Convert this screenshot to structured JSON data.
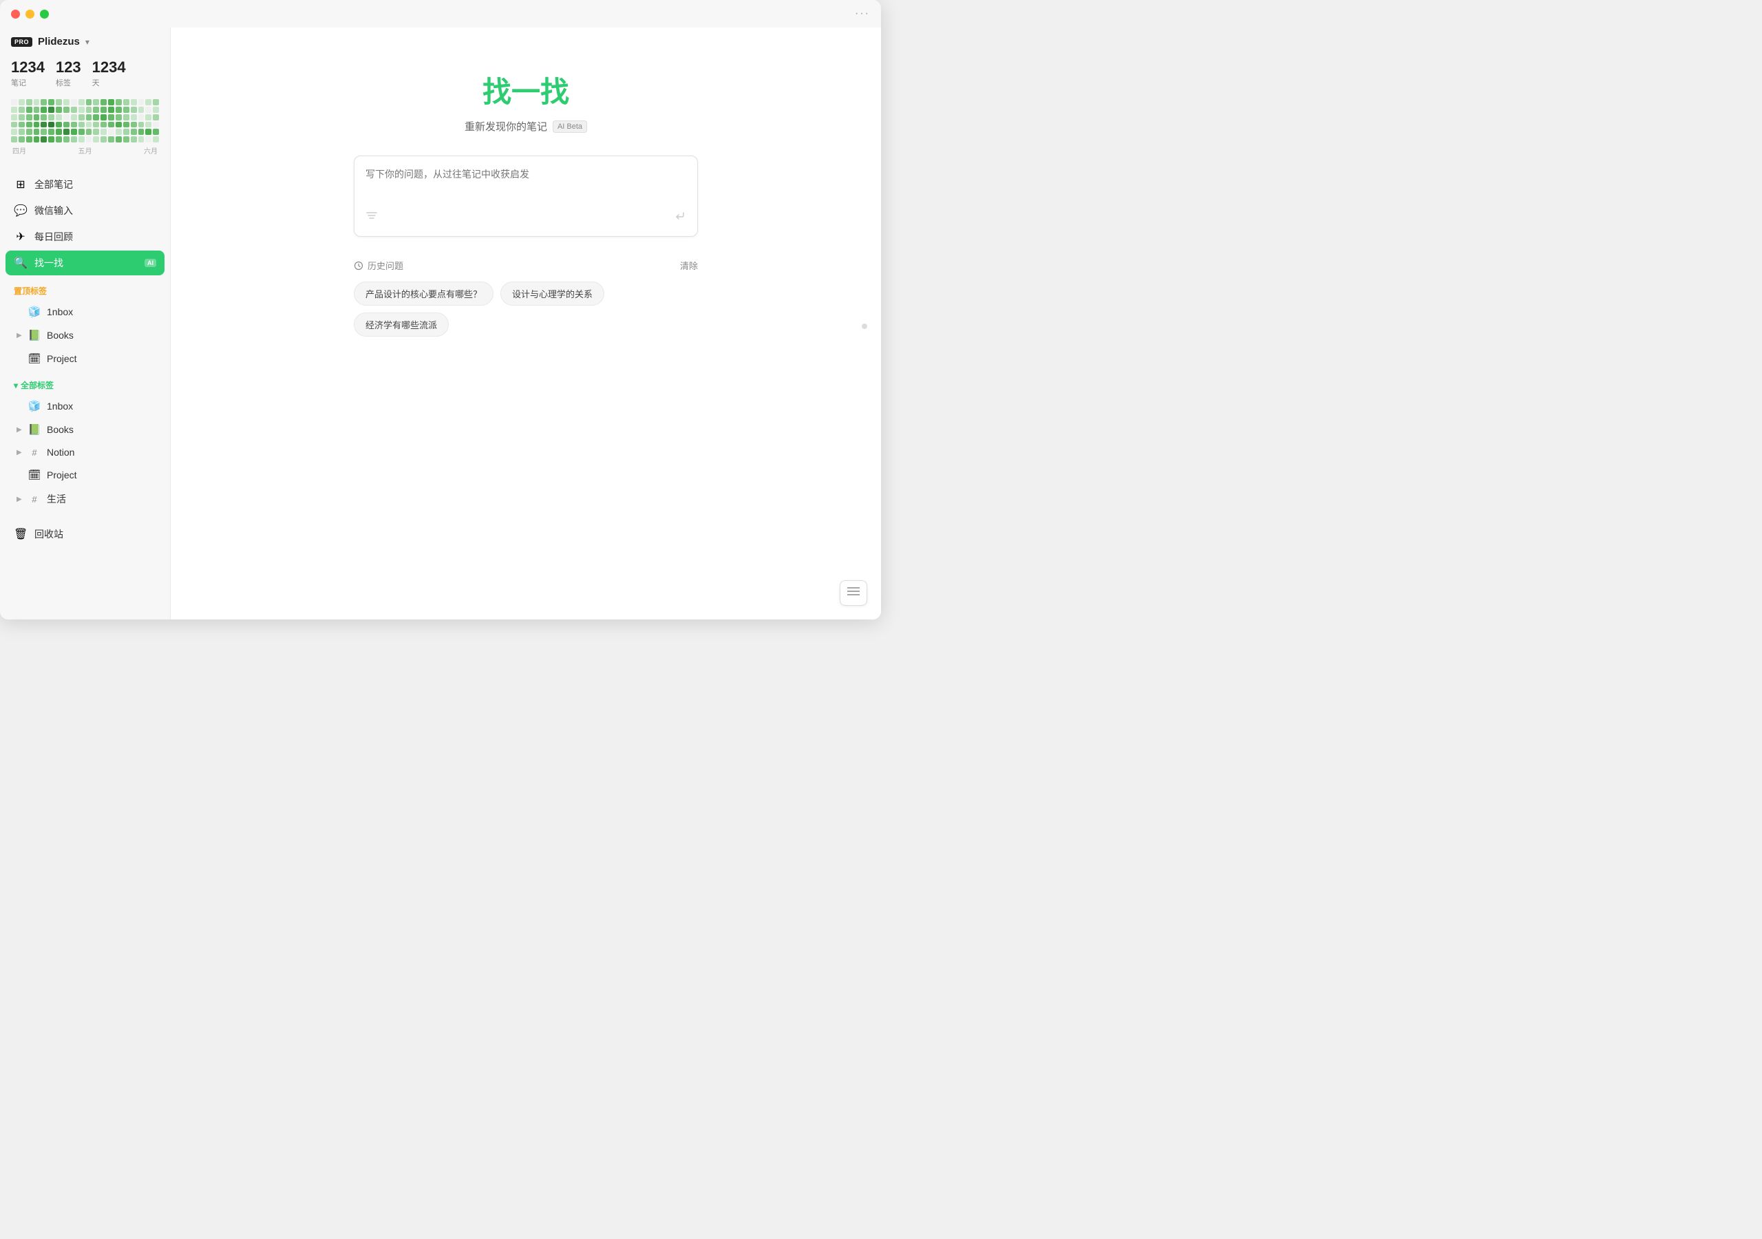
{
  "window": {
    "title": "Plidezus",
    "dots_icon": "···"
  },
  "profile": {
    "pro_label": "PRO",
    "name": "Plidezus",
    "chevron": "▾"
  },
  "stats": [
    {
      "value": "1234",
      "label": "笔记"
    },
    {
      "value": "123",
      "label": "标签"
    },
    {
      "value": "1234",
      "label": "天"
    }
  ],
  "heatmap": {
    "months": [
      "四月",
      "五月",
      "六月"
    ],
    "cells": [
      0,
      1,
      2,
      1,
      3,
      4,
      2,
      1,
      0,
      1,
      3,
      2,
      4,
      5,
      3,
      2,
      1,
      0,
      1,
      2,
      1,
      2,
      4,
      3,
      5,
      6,
      4,
      3,
      2,
      1,
      2,
      3,
      4,
      5,
      4,
      3,
      2,
      1,
      0,
      1,
      1,
      2,
      3,
      4,
      3,
      2,
      1,
      0,
      1,
      2,
      3,
      4,
      5,
      4,
      3,
      2,
      1,
      0,
      1,
      2,
      2,
      3,
      4,
      5,
      6,
      7,
      5,
      4,
      3,
      2,
      1,
      2,
      3,
      4,
      5,
      4,
      3,
      2,
      1,
      0,
      1,
      2,
      3,
      4,
      3,
      4,
      5,
      6,
      5,
      4,
      3,
      2,
      1,
      0,
      1,
      2,
      3,
      4,
      5,
      4,
      2,
      3,
      4,
      5,
      6,
      5,
      4,
      3,
      2,
      1,
      0,
      1,
      2,
      3,
      4,
      3,
      2,
      1,
      0,
      1
    ]
  },
  "nav": {
    "items": [
      {
        "id": "all-notes",
        "icon": "⊞",
        "label": "全部笔记",
        "active": false
      },
      {
        "id": "wechat-input",
        "icon": "💬",
        "label": "微信输入",
        "active": false
      },
      {
        "id": "daily-review",
        "icon": "✈",
        "label": "每日回顾",
        "active": false
      },
      {
        "id": "search",
        "icon": "🔍",
        "label": "找一找",
        "active": true,
        "ai_badge": "AI"
      }
    ]
  },
  "pinned_tags": {
    "label": "置顶标签",
    "items": [
      {
        "id": "inbox-pinned",
        "emoji": "🧊",
        "label": "1nbox",
        "has_chevron": false
      },
      {
        "id": "books-pinned",
        "emoji": "📗",
        "label": "Books",
        "has_chevron": true
      },
      {
        "id": "project-pinned",
        "emoji": "🗓",
        "label": "Project",
        "has_chevron": false
      }
    ]
  },
  "all_tags": {
    "label": "全部标签",
    "items": [
      {
        "id": "inbox-all",
        "emoji": "🧊",
        "label": "1nbox",
        "has_chevron": false
      },
      {
        "id": "books-all",
        "emoji": "📗",
        "label": "Books",
        "has_chevron": true
      },
      {
        "id": "notion-all",
        "emoji": "#",
        "label": "Notion",
        "has_chevron": true,
        "is_hash": true
      },
      {
        "id": "project-all",
        "emoji": "🗓",
        "label": "Project",
        "has_chevron": false
      },
      {
        "id": "life-all",
        "emoji": "#",
        "label": "生活",
        "has_chevron": true,
        "is_hash": true
      }
    ]
  },
  "trash": {
    "icon": "🗑",
    "label": "回收站"
  },
  "main": {
    "title": "找一找",
    "subtitle": "重新发现你的笔记",
    "ai_beta": "AI Beta",
    "search_placeholder": "写下你的问题，从过往笔记中收获启发",
    "history_label": "历史问题",
    "clear_label": "清除",
    "history_items": [
      "产品设计的核心要点有哪些？",
      "设计与心理学的关系",
      "经济学有哪些流派"
    ]
  }
}
